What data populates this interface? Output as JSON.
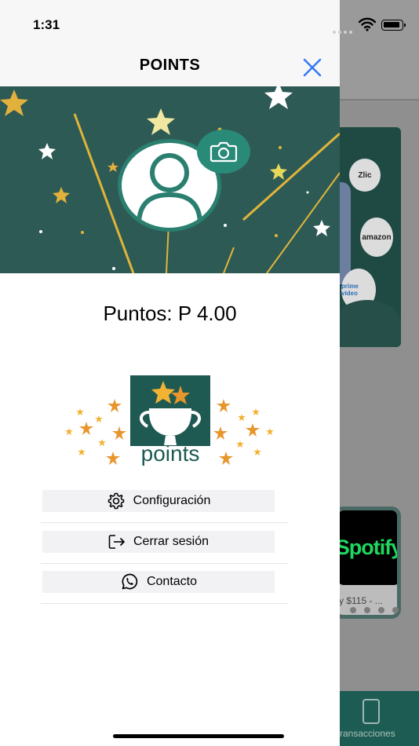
{
  "status_bar": {
    "time": "1:31"
  },
  "drawer": {
    "title": "POINTS",
    "points_label": "Puntos: P 4.00",
    "logo_text": "points",
    "menu": [
      {
        "label": "Configuración",
        "icon": "gear-icon"
      },
      {
        "label": "Cerrar sesión",
        "icon": "logout-icon"
      },
      {
        "label": "Contacto",
        "icon": "whatsapp-icon"
      }
    ]
  },
  "background": {
    "card_bubbles": [
      "Zlic",
      "amazon",
      "prime video"
    ],
    "spotify_label": "Spotify",
    "price_text": "y $115 - ...",
    "tab_label": "ransacciones"
  },
  "colors": {
    "accent_blue": "#3478f6",
    "brand_green": "#1e5a52",
    "banner_bg": "#2e5a55",
    "camera_button": "#2a8a78",
    "star_gold": "#f2b233"
  }
}
